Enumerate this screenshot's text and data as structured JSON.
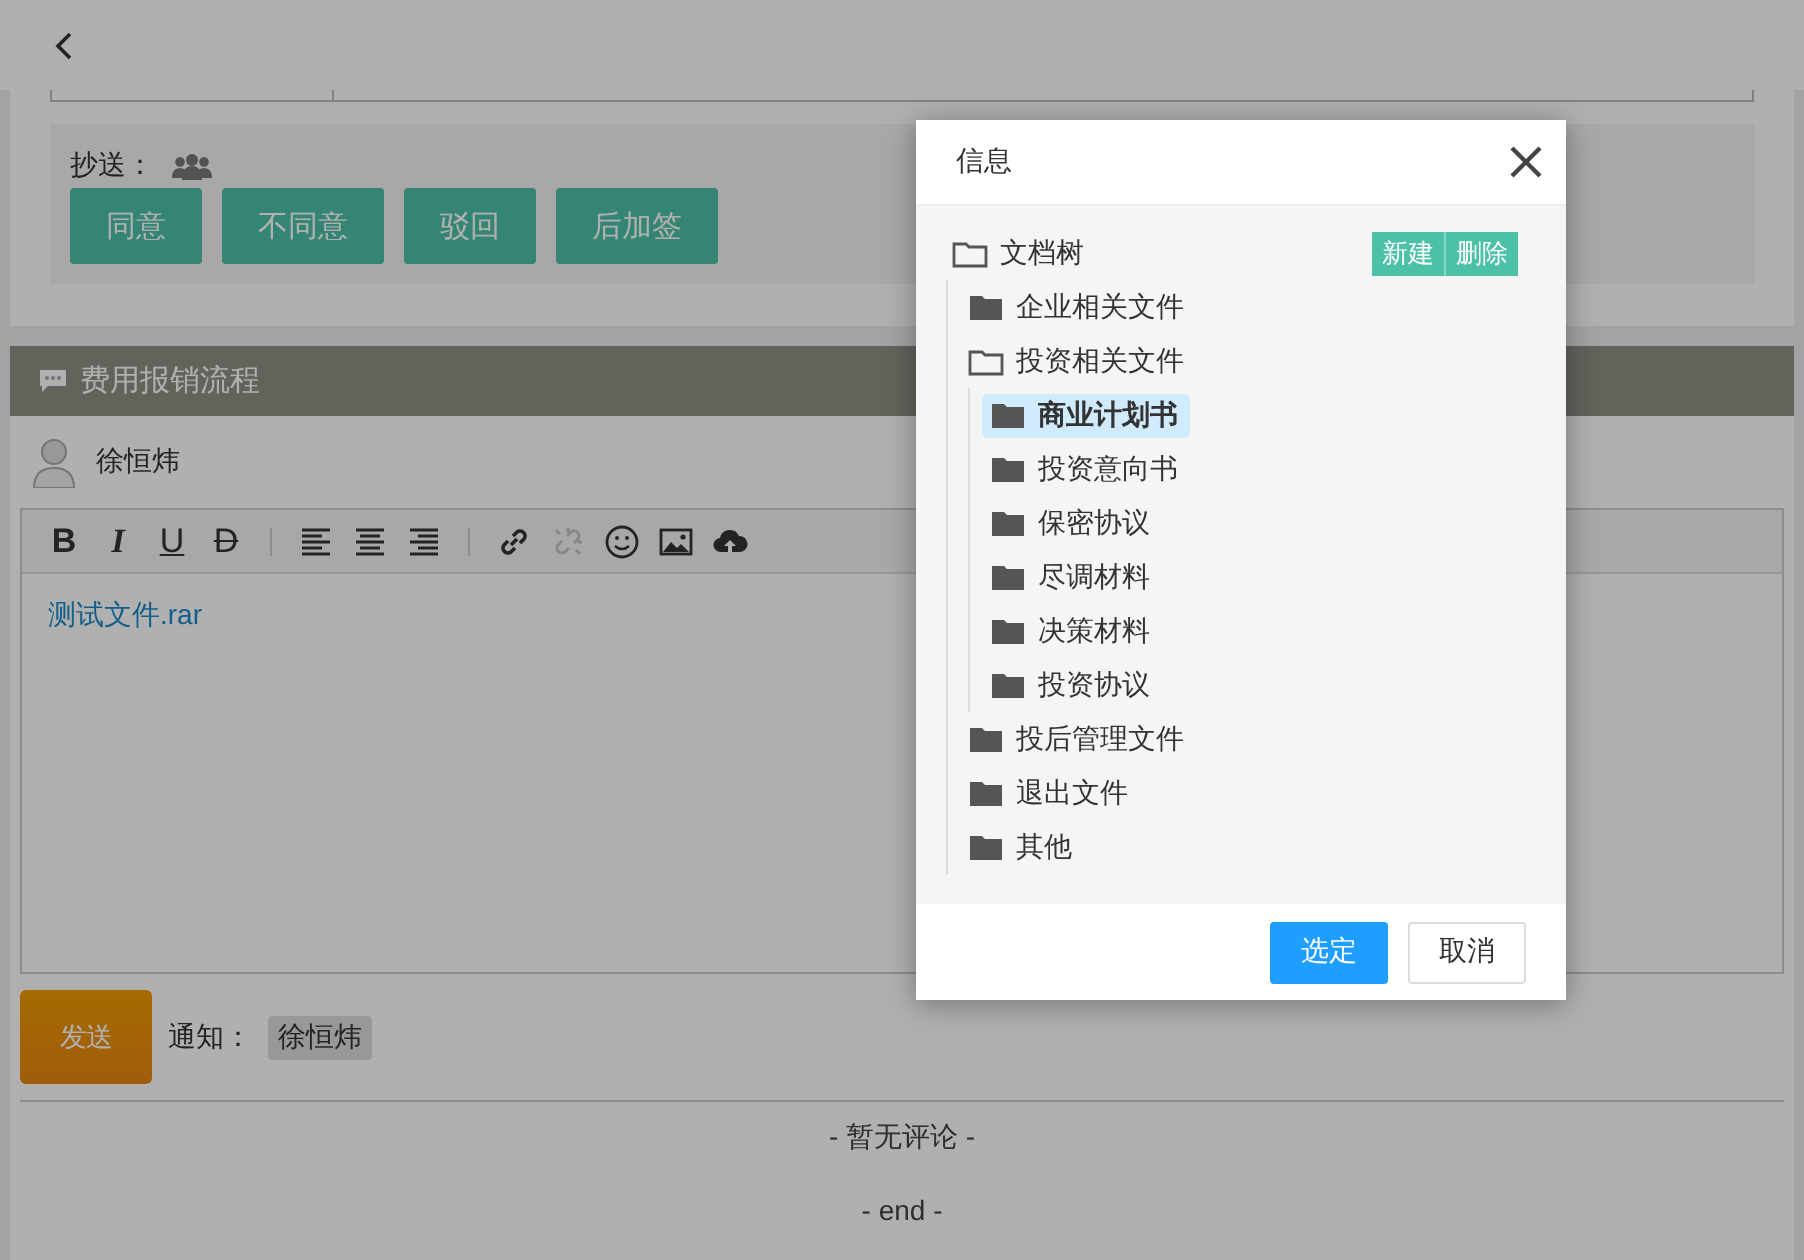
{
  "approval": {
    "cc_label": "抄送：",
    "buttons": [
      "同意",
      "不同意",
      "驳回",
      "后加签"
    ]
  },
  "process": {
    "title": "费用报销流程",
    "user": "徐恒炜",
    "toolbar": [
      {
        "kind": "bold",
        "label": "B",
        "disabled": false
      },
      {
        "kind": "italic",
        "label": "I",
        "disabled": false
      },
      {
        "kind": "underline",
        "label": "U",
        "disabled": false
      },
      {
        "kind": "strike",
        "label": "D",
        "disabled": false
      },
      {
        "kind": "align-left",
        "disabled": false
      },
      {
        "kind": "align-center",
        "disabled": false
      },
      {
        "kind": "align-right",
        "disabled": false
      },
      {
        "kind": "link",
        "disabled": false
      },
      {
        "kind": "unlink",
        "disabled": true
      },
      {
        "kind": "emoji",
        "disabled": false
      },
      {
        "kind": "image",
        "disabled": false
      },
      {
        "kind": "upload",
        "disabled": false
      }
    ],
    "content_link": "测试文件.rar"
  },
  "send": {
    "button": "发送",
    "notify_label": "通知：",
    "recipients": [
      "徐恒炜"
    ]
  },
  "comments": {
    "empty": "- 暂无评论 -",
    "end": "- end -"
  },
  "dialog": {
    "title": "信息",
    "tree_actions": [
      "新建",
      "删除"
    ],
    "tree": {
      "label": "文档树",
      "expanded": true,
      "selected": false,
      "children": [
        {
          "label": "企业相关文件",
          "expanded": false,
          "selected": false
        },
        {
          "label": "投资相关文件",
          "expanded": true,
          "selected": false,
          "children": [
            {
              "label": "商业计划书",
              "expanded": false,
              "selected": true
            },
            {
              "label": "投资意向书",
              "expanded": false,
              "selected": false
            },
            {
              "label": "保密协议",
              "expanded": false,
              "selected": false
            },
            {
              "label": "尽调材料",
              "expanded": false,
              "selected": false
            },
            {
              "label": "决策材料",
              "expanded": false,
              "selected": false
            },
            {
              "label": "投资协议",
              "expanded": false,
              "selected": false
            }
          ]
        },
        {
          "label": "投后管理文件",
          "expanded": false,
          "selected": false
        },
        {
          "label": "退出文件",
          "expanded": false,
          "selected": false
        },
        {
          "label": "其他",
          "expanded": false,
          "selected": false
        }
      ]
    },
    "buttons": [
      {
        "label": "选定",
        "kind": "primary"
      },
      {
        "label": "取消",
        "kind": "default"
      }
    ]
  }
}
